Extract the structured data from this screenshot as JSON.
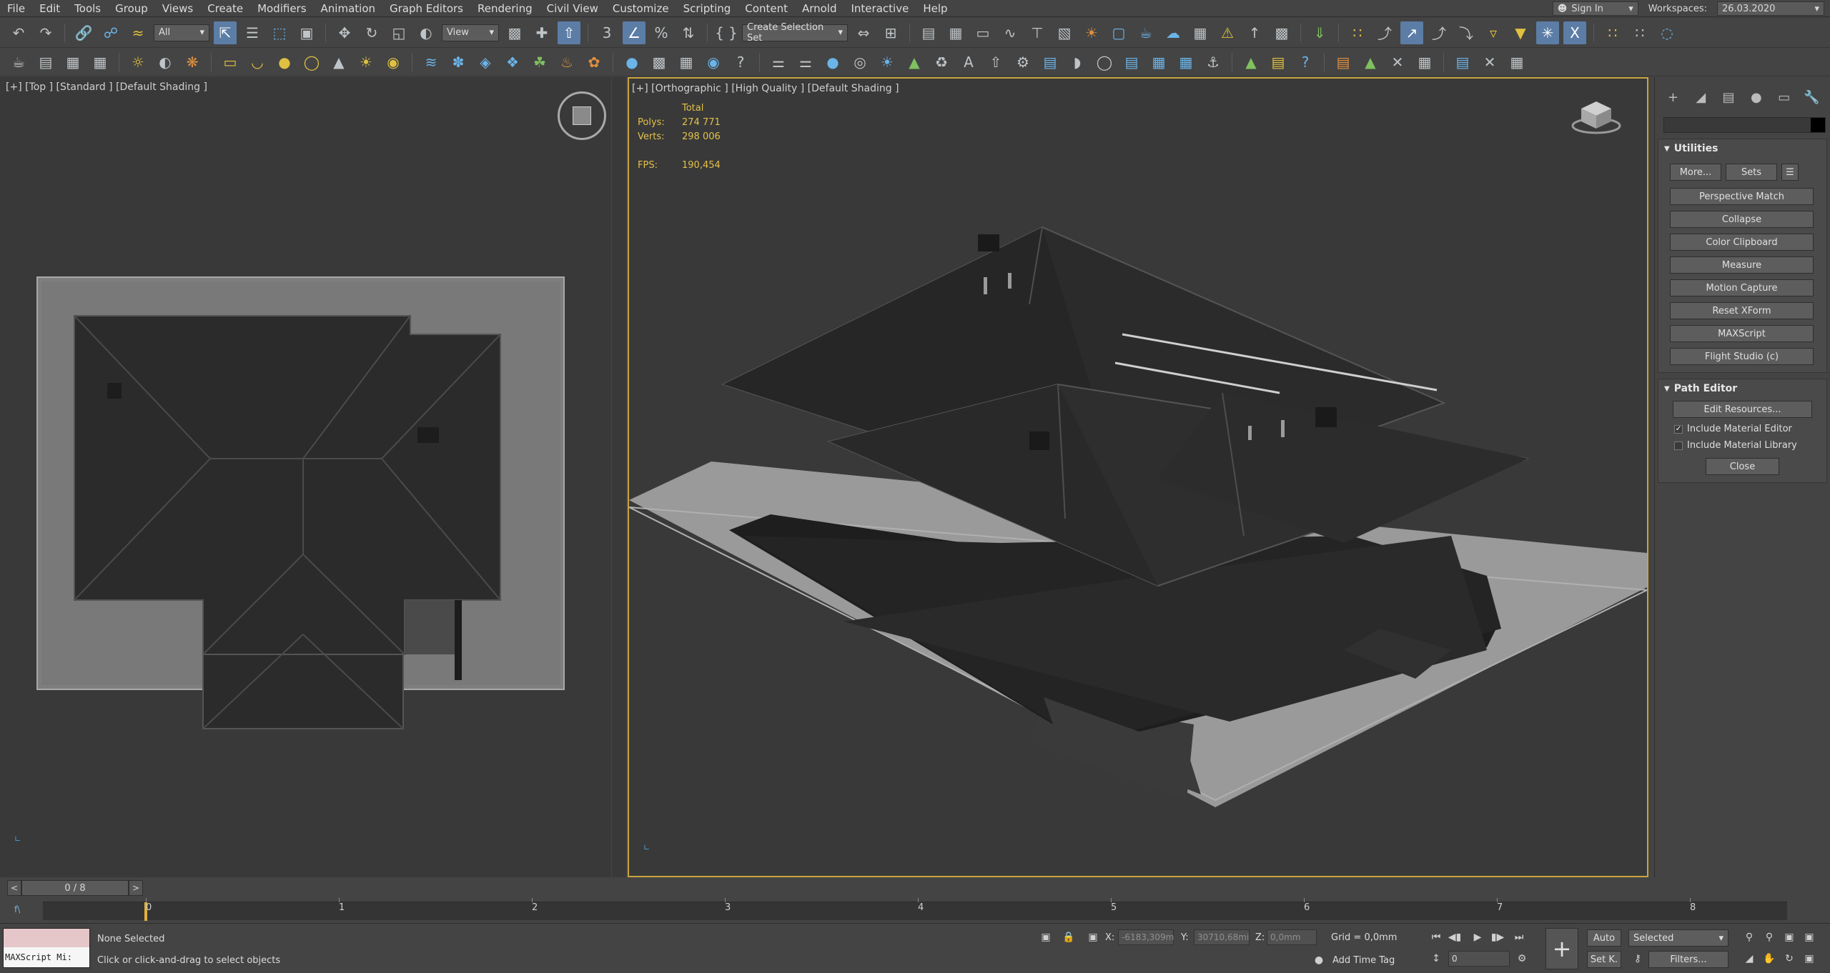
{
  "menu": {
    "items": [
      "File",
      "Edit",
      "Tools",
      "Group",
      "Views",
      "Create",
      "Modifiers",
      "Animation",
      "Graph Editors",
      "Rendering",
      "Civil View",
      "Customize",
      "Scripting",
      "Content",
      "Arnold",
      "Interactive",
      "Help"
    ],
    "signin_label": "Sign In",
    "workspaces_label": "Workspaces:",
    "workspace_value": "26.03.2020"
  },
  "toolbar": {
    "filter_value": "All",
    "view_value": "View",
    "selection_set_placeholder": "Create Selection Set"
  },
  "viewports": {
    "left_label": "[+] [Top ] [Standard ] [Default Shading ]",
    "right_label": "[+] [Orthographic ] [High Quality ] [Default Shading ]",
    "stats": {
      "total_label": "Total",
      "polys_label": "Polys:",
      "polys_value": "274 771",
      "verts_label": "Verts:",
      "verts_value": "298 006",
      "fps_label": "FPS:",
      "fps_value": "190,454"
    }
  },
  "command_panel": {
    "utilities_title": "Utilities",
    "more_label": "More...",
    "sets_label": "Sets",
    "utility_buttons": [
      "Perspective Match",
      "Collapse",
      "Color Clipboard",
      "Measure",
      "Motion Capture",
      "Reset XForm",
      "MAXScript",
      "Flight Studio (c)"
    ],
    "path_editor_title": "Path Editor",
    "edit_resources_label": "Edit Resources...",
    "include_material_editor_label": "Include Material Editor",
    "include_material_library_label": "Include Material Library",
    "close_label": "Close"
  },
  "timeline": {
    "frame_display": "0 / 8",
    "ticks": [
      "0",
      "1",
      "2",
      "3",
      "4",
      "5",
      "6",
      "7",
      "8"
    ]
  },
  "status": {
    "maxscript_label": "MAXScript Mi:",
    "selection_status": "None Selected",
    "prompt": "Click or click-and-drag to select objects",
    "x_label": "X:",
    "x_value": "-6183,309m",
    "y_label": "Y:",
    "y_value": "30710,68mi",
    "z_label": "Z:",
    "z_value": "0,0mm",
    "grid": "Grid = 0,0mm",
    "add_time_tag": "Add Time Tag",
    "auto_label": "Auto",
    "selected_value": "Selected",
    "setk_label": "Set K.",
    "filters_label": "Filters...",
    "frame_value": "0"
  }
}
